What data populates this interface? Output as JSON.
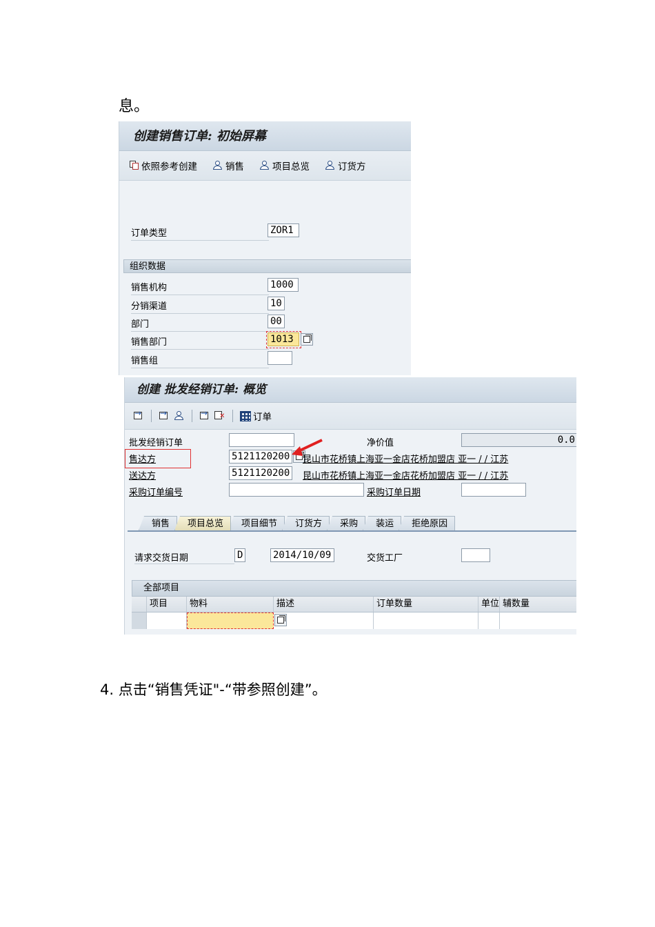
{
  "document": {
    "intro_text": "息。",
    "step4_text": "4. 点击“销售凭证\"-“带参照创建”。"
  },
  "screen1": {
    "title": "创建销售订单: 初始屏幕",
    "toolbar": [
      {
        "label": "依照参考创建",
        "icon": "copy-icon"
      },
      {
        "label": "销售",
        "icon": "person-icon"
      },
      {
        "label": "项目总览",
        "icon": "person-icon"
      },
      {
        "label": "订货方",
        "icon": "person-icon"
      }
    ],
    "order_type": {
      "label": "订单类型",
      "value": "ZOR1"
    },
    "org_section": "组织数据",
    "org_fields": [
      {
        "label": "销售机构",
        "value": "1000"
      },
      {
        "label": "分销渠道",
        "value": "10"
      },
      {
        "label": "部门",
        "value": "00"
      },
      {
        "label": "销售部门",
        "value": "1013"
      },
      {
        "label": "销售组",
        "value": ""
      }
    ]
  },
  "screen2": {
    "title": "创建 批发经销订单: 概览",
    "toolbar_order_label": "订单",
    "fields": {
      "order_no_label": "批发经销订单",
      "order_no_value": "",
      "net_value_label": "净价值",
      "net_value_value": "0.0",
      "sold_to_label": "售达方",
      "sold_to_value": "5121120200",
      "sold_to_desc": "昆山市花桥镇上海亚一金店花桥加盟店  亚一 / / 江苏",
      "ship_to_label": "送达方",
      "ship_to_value": "5121120200",
      "ship_to_desc": "昆山市花桥镇上海亚一金店花桥加盟店  亚一 / / 江苏",
      "po_no_label": "采购订单编号",
      "po_no_value": "",
      "po_date_label": "采购订单日期",
      "po_date_value": ""
    },
    "tabs": [
      "销售",
      "项目总览",
      "项目细节",
      "订货方",
      "采购",
      "装运",
      "拒绝原因"
    ],
    "active_tab": "项目总览",
    "delivery": {
      "req_date_label": "请求交货日期",
      "req_date_unit": "D",
      "req_date_value": "2014/10/09",
      "plant_label": "交货工厂",
      "plant_value": ""
    },
    "items_table": {
      "title": "全部项目",
      "columns": [
        "项目",
        "物料",
        "描述",
        "订单数量",
        "单位",
        "辅数量"
      ]
    }
  }
}
